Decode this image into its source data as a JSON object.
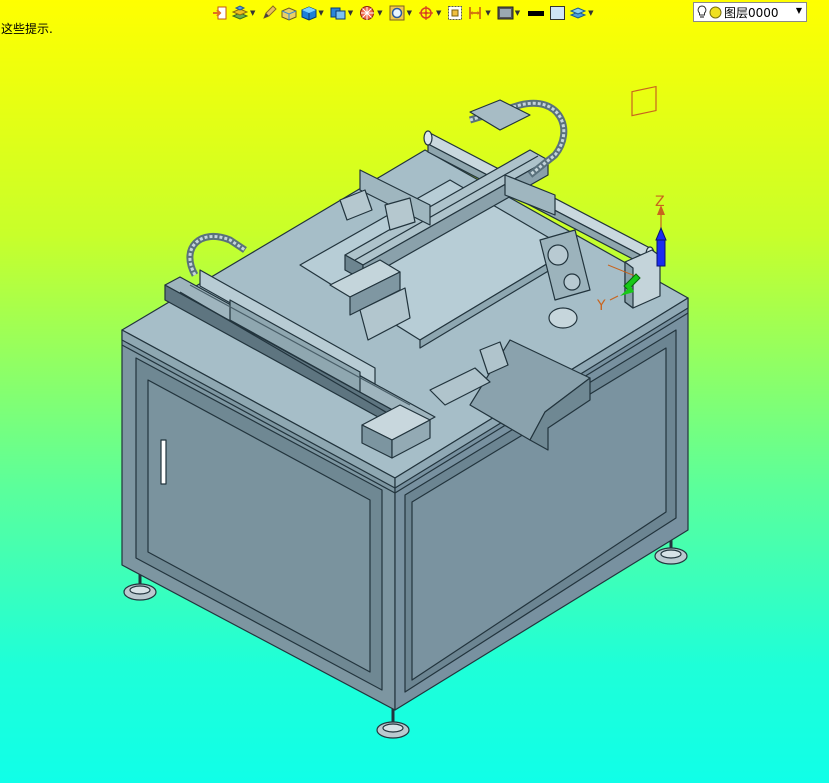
{
  "hint": {
    "text": "这些提示."
  },
  "toolbar": {
    "buttons": [
      {
        "icon": "exit-view-icon",
        "dropdown": false
      },
      {
        "icon": "layers-stack-icon",
        "dropdown": true
      },
      {
        "icon": "pencil-icon",
        "dropdown": false
      },
      {
        "icon": "box-wireframe-icon",
        "dropdown": false
      },
      {
        "icon": "shaded-cube-icon",
        "dropdown": true
      },
      {
        "icon": "view-orientation-icon",
        "dropdown": true
      },
      {
        "icon": "section-plane-icon",
        "dropdown": true
      },
      {
        "icon": "zoom-window-icon",
        "dropdown": true
      },
      {
        "icon": "rotate-axis-icon",
        "dropdown": true
      },
      {
        "icon": "grid-snap-icon",
        "dropdown": false
      },
      {
        "icon": "dimension-icon",
        "dropdown": true
      },
      {
        "icon": "display-mode-icon",
        "dropdown": true
      },
      {
        "icon": "line-color-icon",
        "dropdown": false
      },
      {
        "icon": "fill-color-icon",
        "dropdown": false
      },
      {
        "icon": "layer-manager-icon",
        "dropdown": true
      }
    ]
  },
  "layer_selector": {
    "value": "图层0000"
  },
  "triad": {
    "z_label": "Z",
    "y_label": "Y"
  },
  "colors": {
    "bg_top": "#ffff00",
    "bg_bottom": "#10ffe8",
    "model_top": "#9fb9c4",
    "model_front": "#7f9aa6",
    "model_edge": "#22343d",
    "axis_orange": "#c8641e",
    "axis_blue": "#1a2cf0",
    "axis_green": "#18c818"
  }
}
